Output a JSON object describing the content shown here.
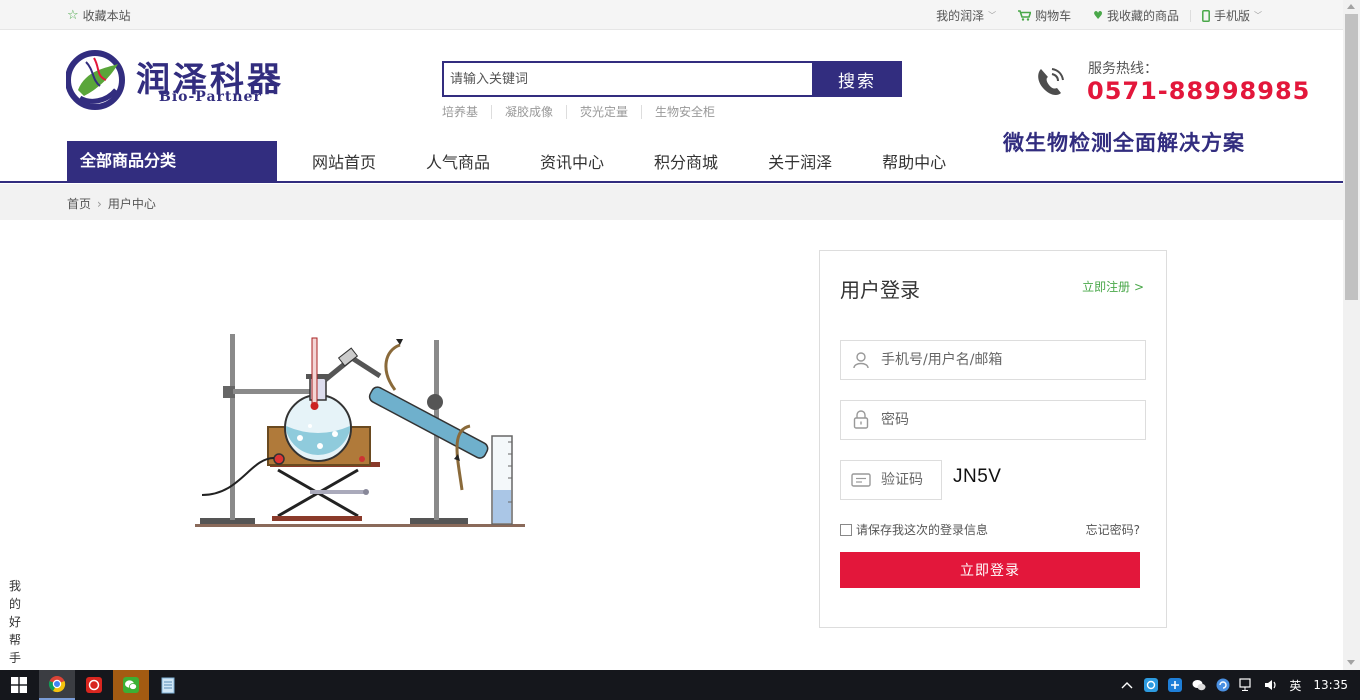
{
  "topbar": {
    "favorite": "收藏本站",
    "my_account": "我的润泽",
    "cart": "购物车",
    "favorites": "我收藏的商品",
    "mobile": "手机版"
  },
  "brand": {
    "name_cn": "润泽科器",
    "name_en": "Bio-Partner",
    "color": "#322d7f"
  },
  "search": {
    "placeholder": "请输入关键词",
    "button": "搜索",
    "hot_words": [
      "培养基",
      "凝胶成像",
      "荧光定量",
      "生物安全柜"
    ]
  },
  "hotline": {
    "label": "服务热线：",
    "number": "0571-88998985"
  },
  "slogan": "微生物检测全面解决方案",
  "nav": {
    "category": "全部商品分类",
    "links": [
      "网站首页",
      "人气商品",
      "资讯中心",
      "积分商城",
      "关于润泽",
      "帮助中心"
    ]
  },
  "breadcrumb": {
    "home": "首页",
    "current": "用户中心"
  },
  "login": {
    "title": "用户登录",
    "register": "立即注册 >",
    "username_placeholder": "手机号/用户名/邮箱",
    "password_placeholder": "密码",
    "code_placeholder": "验证码",
    "captcha": "JN5V",
    "remember": "请保存我这次的登录信息",
    "forgot": "忘记密码?",
    "submit": "立即登录"
  },
  "helper": [
    "我",
    "的",
    "好",
    "帮",
    "手"
  ],
  "taskbar": {
    "ime": "英",
    "time": "13:35"
  },
  "colors": {
    "accent": "#322d7f",
    "danger": "#e3173b",
    "green": "#4aa84a"
  }
}
